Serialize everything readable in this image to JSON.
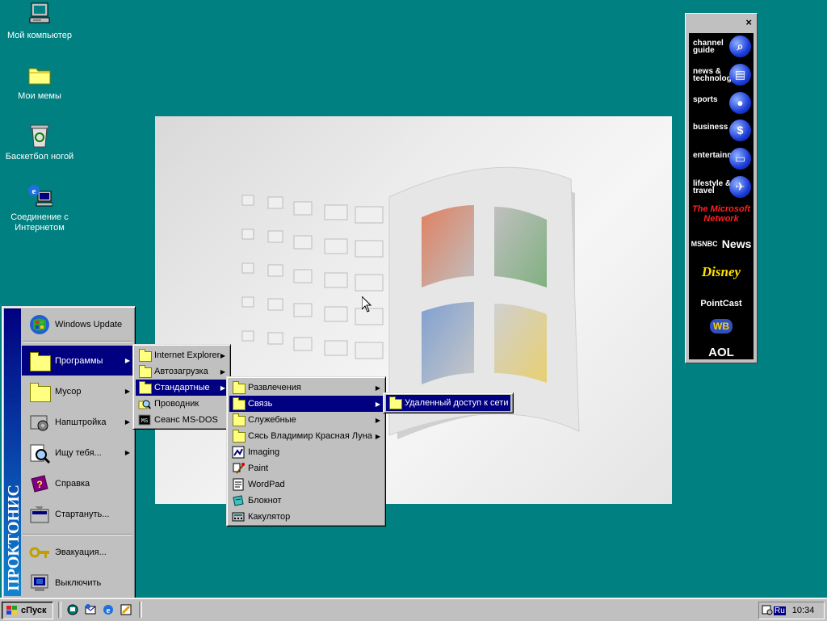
{
  "desktop": {
    "background_color": "#008080",
    "icons": [
      {
        "label": "Мой компьютер",
        "icon": "my-computer-icon"
      },
      {
        "label": "Мои мемы",
        "icon": "folder-icon"
      },
      {
        "label": "Баскетбол ногой",
        "icon": "recycle-bin-icon"
      },
      {
        "label": "Соединение с Интернетом",
        "icon": "internet-connection-icon"
      }
    ]
  },
  "channel_bar": {
    "close": "×",
    "channels": [
      {
        "label": "channel guide",
        "icon": "magnifier-icon"
      },
      {
        "label": "news & technology",
        "icon": "newspaper-icon"
      },
      {
        "label": "sports",
        "icon": "soccer-ball-icon"
      },
      {
        "label": "business",
        "icon": "dollar-icon"
      },
      {
        "label": "entertainment",
        "icon": "tv-icon"
      },
      {
        "label": "lifestyle & travel",
        "icon": "airplane-icon"
      }
    ],
    "logos": [
      "The Microsoft Network",
      "MSNBC",
      "News",
      "Disney",
      "PointCast",
      "WB",
      "AOL"
    ]
  },
  "start_menu": {
    "banner": "ПРОКТОНИС",
    "items": [
      {
        "label": "Windows Update",
        "icon": "windows-update-icon",
        "has_submenu": false
      },
      {
        "label": "Программы",
        "icon": "programs-icon",
        "has_submenu": true,
        "selected": true
      },
      {
        "label": "Мусор",
        "icon": "documents-icon",
        "has_submenu": true
      },
      {
        "label": "Напштройка",
        "icon": "settings-icon",
        "has_submenu": true
      },
      {
        "label": "Ищу тебя...",
        "icon": "find-icon",
        "has_submenu": true
      },
      {
        "label": "Справка",
        "icon": "help-icon",
        "has_submenu": false
      },
      {
        "label": "Стартануть...",
        "icon": "run-icon",
        "has_submenu": false
      },
      {
        "label": "Эвакуация...",
        "icon": "logoff-icon",
        "has_submenu": false
      },
      {
        "label": "Выключить",
        "icon": "shutdown-icon",
        "has_submenu": false
      }
    ]
  },
  "programs_menu": {
    "items": [
      {
        "label": "Internet Explorer",
        "icon": "folder-icon",
        "has_submenu": true
      },
      {
        "label": "Автозагрузка",
        "icon": "folder-icon",
        "has_submenu": true
      },
      {
        "label": "Стандартные",
        "icon": "folder-icon",
        "has_submenu": true,
        "selected": true
      },
      {
        "label": "Проводник",
        "icon": "explorer-icon",
        "has_submenu": false
      },
      {
        "label": "Сеанс MS-DOS",
        "icon": "ms-dos-icon",
        "has_submenu": false
      }
    ]
  },
  "accessories_menu": {
    "items": [
      {
        "label": "Развлечения",
        "icon": "folder-icon",
        "has_submenu": true
      },
      {
        "label": "Связь",
        "icon": "folder-icon",
        "has_submenu": true,
        "selected": true
      },
      {
        "label": "Служебные",
        "icon": "folder-icon",
        "has_submenu": true
      },
      {
        "label": "Сясь Владимир Красная Луна",
        "icon": "folder-icon",
        "has_submenu": true
      },
      {
        "label": "Imaging",
        "icon": "imaging-icon",
        "has_submenu": false
      },
      {
        "label": "Paint",
        "icon": "paint-icon",
        "has_submenu": false
      },
      {
        "label": "WordPad",
        "icon": "wordpad-icon",
        "has_submenu": false
      },
      {
        "label": "Блокнот",
        "icon": "notepad-icon",
        "has_submenu": false
      },
      {
        "label": "Какулятор",
        "icon": "calculator-icon",
        "has_submenu": false
      }
    ]
  },
  "communications_menu": {
    "items": [
      {
        "label": "Удаленный доступ к сети",
        "icon": "dialup-icon",
        "selected": true
      }
    ]
  },
  "taskbar": {
    "start_label": "сПуск",
    "quick_launch": [
      "show-desktop-icon",
      "outlook-express-icon",
      "internet-explorer-icon",
      "channels-icon"
    ],
    "tray": {
      "lang": "Ru",
      "clock": "10:34"
    }
  }
}
